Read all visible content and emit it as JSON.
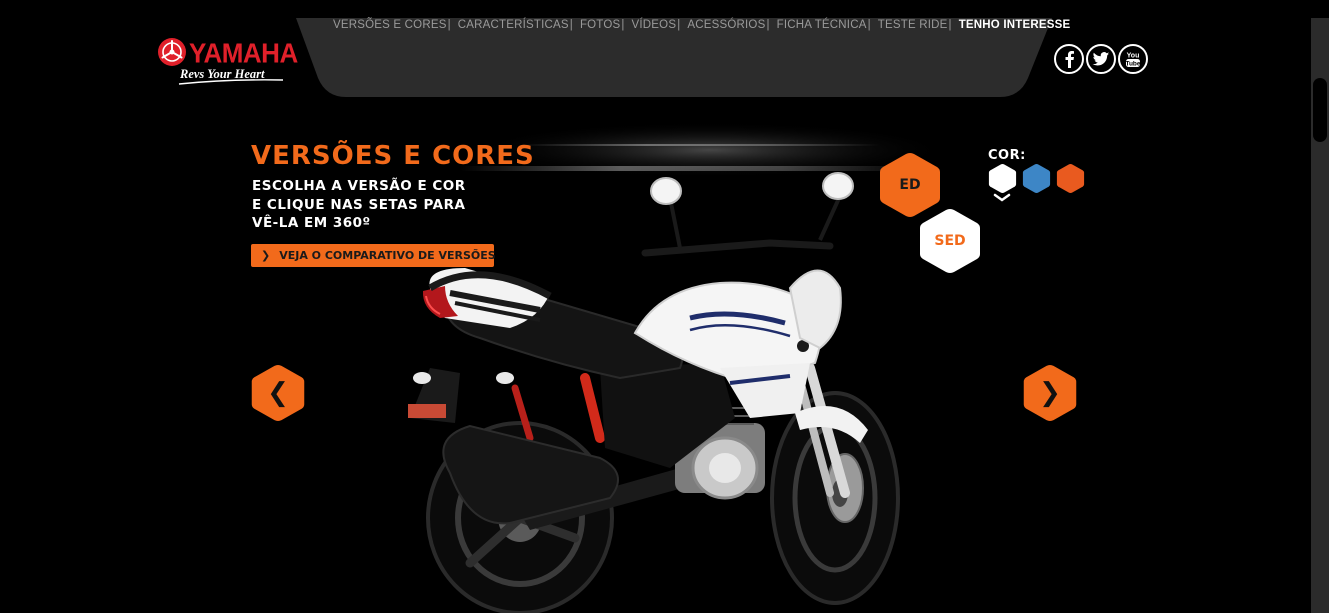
{
  "brand": {
    "name": "YAMAHA",
    "tagline": "Revs Your Heart",
    "color": "#e0202a"
  },
  "nav": {
    "items": [
      {
        "label": "VERSÕES E CORES"
      },
      {
        "label": "CARACTERÍSTICAS"
      },
      {
        "label": "FOTOS"
      },
      {
        "label": "VÍDEOS"
      },
      {
        "label": "ACESSÓRIOS"
      },
      {
        "label": "FICHA TÉCNICA"
      },
      {
        "label": "TESTE RIDE"
      },
      {
        "label": "TENHO INTERESSE",
        "active": true
      }
    ],
    "separator": "|"
  },
  "social": [
    {
      "icon": "facebook-icon"
    },
    {
      "icon": "twitter-icon"
    },
    {
      "icon": "youtube-icon"
    }
  ],
  "main": {
    "title": "VERSÕES E CORES",
    "instructions": [
      "ESCOLHA A VERSÃO E COR",
      "E CLIQUE NAS SETAS PARA",
      "VÊ-LA EM 360º"
    ],
    "compare_button": "VEJA O COMPARATIVO DE VERSÕES",
    "accent_color": "#f26a1b"
  },
  "versions": [
    {
      "label": "ED",
      "selected": false
    },
    {
      "label": "SED",
      "selected": true
    }
  ],
  "colors": {
    "label": "COR:",
    "swatches": [
      {
        "name": "white",
        "hex": "#ffffff",
        "selected": true
      },
      {
        "name": "blue",
        "hex": "#3d86c6",
        "selected": false
      },
      {
        "name": "orange",
        "hex": "#e95a1f",
        "selected": false
      }
    ]
  },
  "arrows": {
    "prev": "❮",
    "next": "❯"
  }
}
